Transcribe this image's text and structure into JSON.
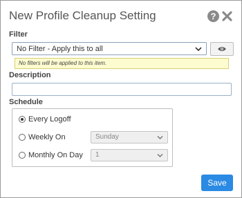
{
  "dialog": {
    "title": "New Profile Cleanup Setting",
    "help_glyph": "?"
  },
  "filter": {
    "label": "Filter",
    "selected": "No Filter - Apply this to all",
    "hint": "No filters will be applied to this item."
  },
  "description": {
    "label": "Description",
    "value": ""
  },
  "schedule": {
    "label": "Schedule",
    "options": [
      {
        "label": "Every Logoff",
        "checked": true
      },
      {
        "label": "Weekly On",
        "checked": false,
        "select_value": "Sunday"
      },
      {
        "label": "Monthly On Day",
        "checked": false,
        "select_value": "1"
      }
    ]
  },
  "actions": {
    "save_label": "Save"
  },
  "colors": {
    "accent": "#2b8ae3",
    "hint_bg": "#fdfbd0"
  },
  "icons": [
    "help-icon",
    "close-icon",
    "eye-icon",
    "chevron-down-icon"
  ]
}
